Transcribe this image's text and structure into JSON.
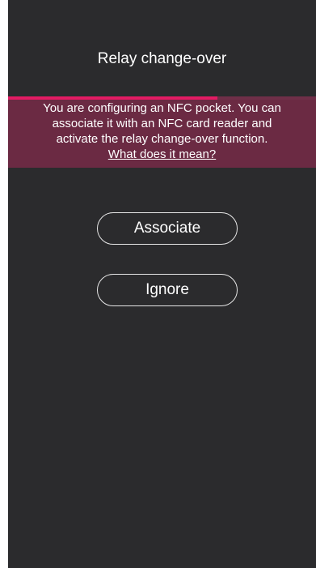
{
  "header": {
    "title": "Relay change-over"
  },
  "progress": {
    "fraction": 0.68,
    "fill_color": "#e21b63",
    "track_color": "#6f2f48"
  },
  "info": {
    "line1": "You are configuring an NFC pocket. You can",
    "line2": "associate it with an NFC card reader and",
    "line3": "activate the relay change-over function.",
    "link": "What does it mean?",
    "background_color": "#6b2a43"
  },
  "actions": {
    "associate_label": "Associate",
    "ignore_label": "Ignore"
  },
  "colors": {
    "screen_background": "#2b2b2d",
    "accent": "#e21b63"
  }
}
